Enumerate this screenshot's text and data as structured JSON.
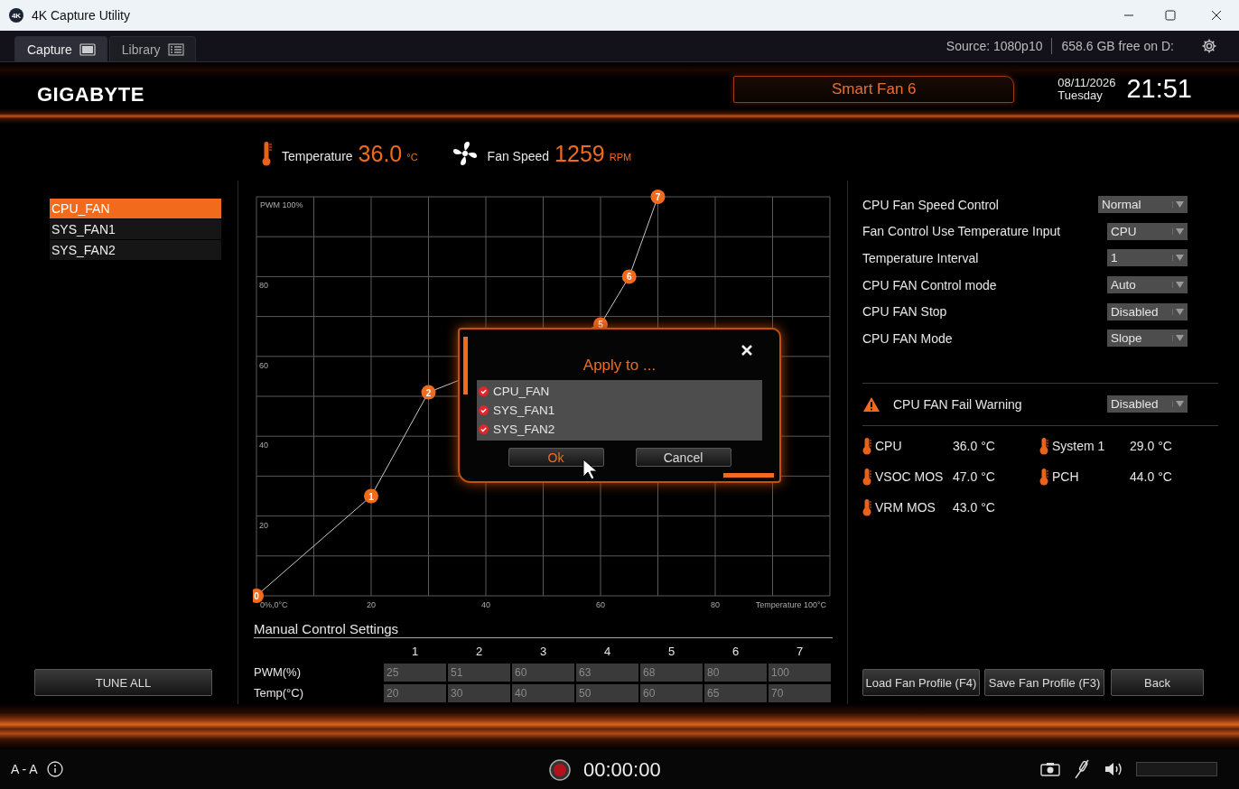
{
  "window": {
    "icon_text": "4K",
    "title": "4K Capture Utility"
  },
  "tabs": [
    {
      "label": "Capture",
      "kind": "monitor",
      "selected": true
    },
    {
      "label": "Library",
      "kind": "grid",
      "selected": false
    }
  ],
  "toolbar": {
    "source": "Source: 1080p10",
    "free_space": "658.6 GB free on D:"
  },
  "header": {
    "logo": "GIGABYTE",
    "page_title": "Smart Fan 6",
    "date": "08/11/2026",
    "weekday": "Tuesday",
    "time": "21:51"
  },
  "readings": [
    {
      "kind": "temperature",
      "label": "Temperature",
      "value": "36.0",
      "unit": "°C"
    },
    {
      "kind": "fan",
      "label": "Fan Speed",
      "value": "1259",
      "unit": "RPM"
    }
  ],
  "fans": [
    {
      "name": "CPU_FAN",
      "selected": true
    },
    {
      "name": "SYS_FAN1",
      "selected": false
    },
    {
      "name": "SYS_FAN2",
      "selected": false
    }
  ],
  "tune_all": "TUNE ALL",
  "curve": {
    "y_top_label": "PWM 100%",
    "origin_label": "0%,0°C",
    "x_end_label": "Temperature 100°C",
    "point_labels": [
      "0",
      "1",
      "2",
      "5",
      "6",
      "7"
    ],
    "chart_data": {
      "type": "line",
      "x": [
        0,
        20,
        30,
        60,
        65,
        70
      ],
      "series": [
        {
          "color": "#c8c8c8",
          "marker": "circle",
          "values": [
            0,
            25,
            51,
            68,
            80,
            100
          ]
        }
      ],
      "xlim": [
        0,
        100
      ],
      "ylim": [
        0,
        100
      ],
      "xticks": [
        20,
        40,
        60,
        80
      ],
      "yticks": [
        20,
        40,
        60,
        80
      ],
      "grid": true
    }
  },
  "manual": {
    "title": "Manual Control Settings",
    "columns": [
      "1",
      "2",
      "3",
      "4",
      "5",
      "6",
      "7"
    ],
    "rows": [
      {
        "label": "PWM(%)",
        "values": [
          "25",
          "51",
          "60",
          "63",
          "68",
          "80",
          "100"
        ]
      },
      {
        "label": "Temp(°C)",
        "values": [
          "20",
          "30",
          "40",
          "50",
          "60",
          "65",
          "70"
        ]
      }
    ]
  },
  "settings": [
    {
      "label": "CPU Fan Speed Control",
      "value": "Normal",
      "wide": true
    },
    {
      "label": "Fan Control Use Temperature Input",
      "value": "CPU",
      "wide": false
    },
    {
      "label": "Temperature Interval",
      "value": "1",
      "wide": false
    },
    {
      "label": "CPU FAN Control mode",
      "value": "Auto",
      "wide": false
    },
    {
      "label": "CPU FAN Stop",
      "value": "Disabled",
      "wide": false
    },
    {
      "label": "CPU FAN Mode",
      "value": "Slope",
      "wide": false
    }
  ],
  "fail_warning": {
    "label": "CPU FAN Fail Warning",
    "value": "Disabled"
  },
  "sensors": [
    {
      "name": "CPU",
      "value": "36.0 °C"
    },
    {
      "name": "System 1",
      "value": "29.0 °C"
    },
    {
      "name": "VSOC MOS",
      "value": "47.0 °C"
    },
    {
      "name": "PCH",
      "value": "44.0 °C"
    },
    {
      "name": "VRM MOS",
      "value": "43.0 °C"
    }
  ],
  "buttons": [
    "Load Fan Profile (F4)",
    "Save Fan Profile (F3)",
    "Back"
  ],
  "dialog": {
    "title": "Apply to ...",
    "items": [
      {
        "label": "CPU_FAN",
        "checked": true
      },
      {
        "label": "SYS_FAN1",
        "checked": true
      },
      {
        "label": "SYS_FAN2",
        "checked": true
      }
    ],
    "buttons": [
      {
        "label": "Ok",
        "kind": "primary"
      },
      {
        "label": "Cancel",
        "kind": "normal"
      }
    ]
  },
  "status_bar": {
    "font_toggle": "A - A",
    "timer": "00:00:00"
  }
}
